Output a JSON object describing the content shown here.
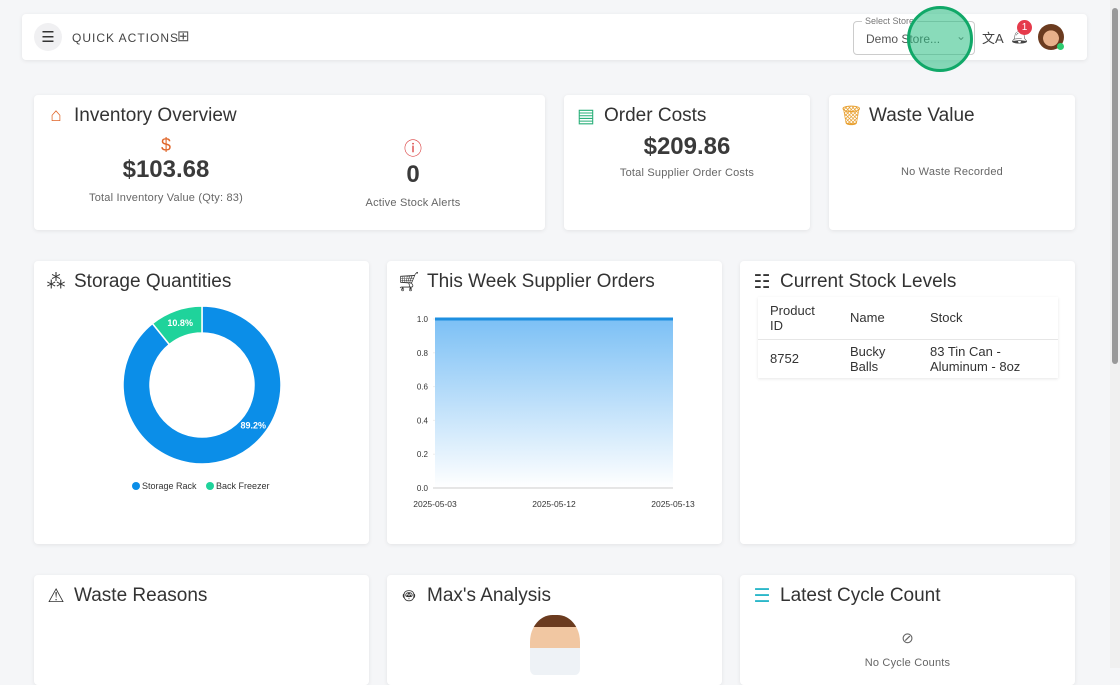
{
  "header": {
    "quick_actions": "QUICK ACTIONS",
    "store_label": "Select Store",
    "store_value": "Demo Store...",
    "notif_count": "1"
  },
  "inventory": {
    "title": "Inventory Overview",
    "total_value": "$103.68",
    "total_label": "Total Inventory Value (Qty: 83)",
    "alerts": "0",
    "alerts_label": "Active Stock Alerts"
  },
  "orders": {
    "title": "Order Costs",
    "value": "$209.86",
    "label": "Total Supplier Order Costs"
  },
  "waste": {
    "title": "Waste Value",
    "empty": "No Waste Recorded"
  },
  "storage": {
    "title": "Storage Quantities"
  },
  "supplier": {
    "title": "This Week Supplier Orders"
  },
  "stock": {
    "title": "Current Stock Levels",
    "headers": [
      "Product ID",
      "Name",
      "Stock"
    ],
    "rows": [
      [
        "8752",
        "Bucky Balls",
        "83 Tin Can - Aluminum - 8oz"
      ]
    ]
  },
  "waste_reasons": {
    "title": "Waste Reasons"
  },
  "max": {
    "title": "Max's Analysis"
  },
  "cycle": {
    "title": "Latest Cycle Count",
    "empty": "No Cycle Counts"
  },
  "chart_data": [
    {
      "type": "pie",
      "title": "Storage Quantities",
      "categories": [
        "Storage Rack",
        "Back Freezer"
      ],
      "values": [
        89.2,
        10.8
      ],
      "labels": [
        "89.2%",
        "10.8%"
      ],
      "colors": [
        "#0b8ee8",
        "#1fd39b"
      ],
      "legend": "bottom"
    },
    {
      "type": "area",
      "title": "This Week Supplier Orders",
      "x": [
        "2025-05-03",
        "2025-05-12",
        "2025-05-13"
      ],
      "values": [
        1,
        1,
        1
      ],
      "ylim": [
        0,
        1
      ],
      "yticks": [
        "0.0",
        "0.2",
        "0.4",
        "0.6",
        "0.8",
        "1.0"
      ],
      "color": "#1e8fe0"
    }
  ]
}
